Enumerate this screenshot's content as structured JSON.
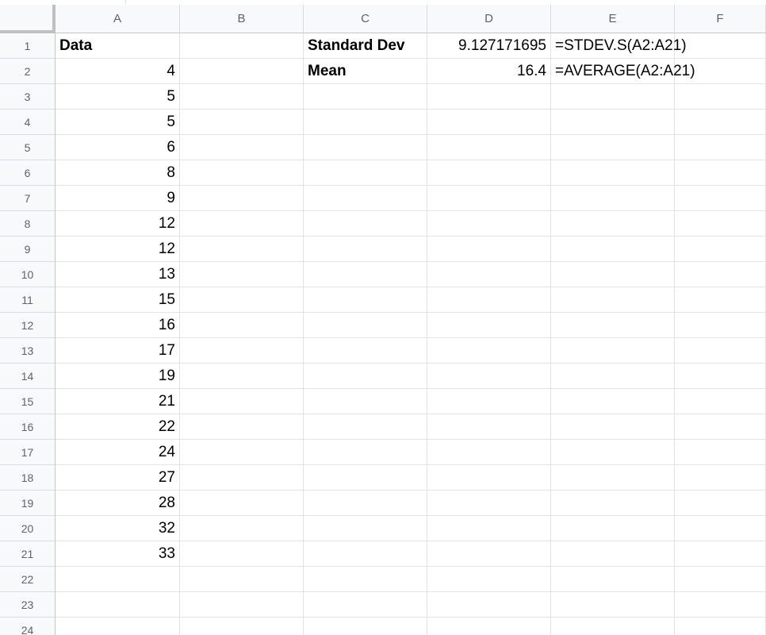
{
  "columns": [
    "A",
    "B",
    "C",
    "D",
    "E",
    "F"
  ],
  "rows": [
    "1",
    "2",
    "3",
    "4",
    "5",
    "6",
    "7",
    "8",
    "9",
    "10",
    "11",
    "12",
    "13",
    "14",
    "15",
    "16",
    "17",
    "18",
    "19",
    "20",
    "21",
    "22",
    "23",
    "24"
  ],
  "cells": {
    "A1": "Data",
    "A2": "4",
    "A3": "5",
    "A4": "5",
    "A5": "6",
    "A6": "8",
    "A7": "9",
    "A8": "12",
    "A9": "12",
    "A10": "13",
    "A11": "15",
    "A12": "16",
    "A13": "17",
    "A14": "19",
    "A15": "21",
    "A16": "22",
    "A17": "24",
    "A18": "27",
    "A19": "28",
    "A20": "32",
    "A21": "33",
    "C1": "Standard Dev",
    "D1": "9.127171695",
    "E1": "=STDEV.S(A2:A21)",
    "C2": "Mean",
    "D2": "16.4",
    "E2": "=AVERAGE(A2:A21)"
  },
  "colors": {
    "header_bg": "#f8f9fa",
    "header_text": "#5f6368",
    "gridline": "#e2e3e3",
    "frozen_border": "#c0c0c0"
  }
}
